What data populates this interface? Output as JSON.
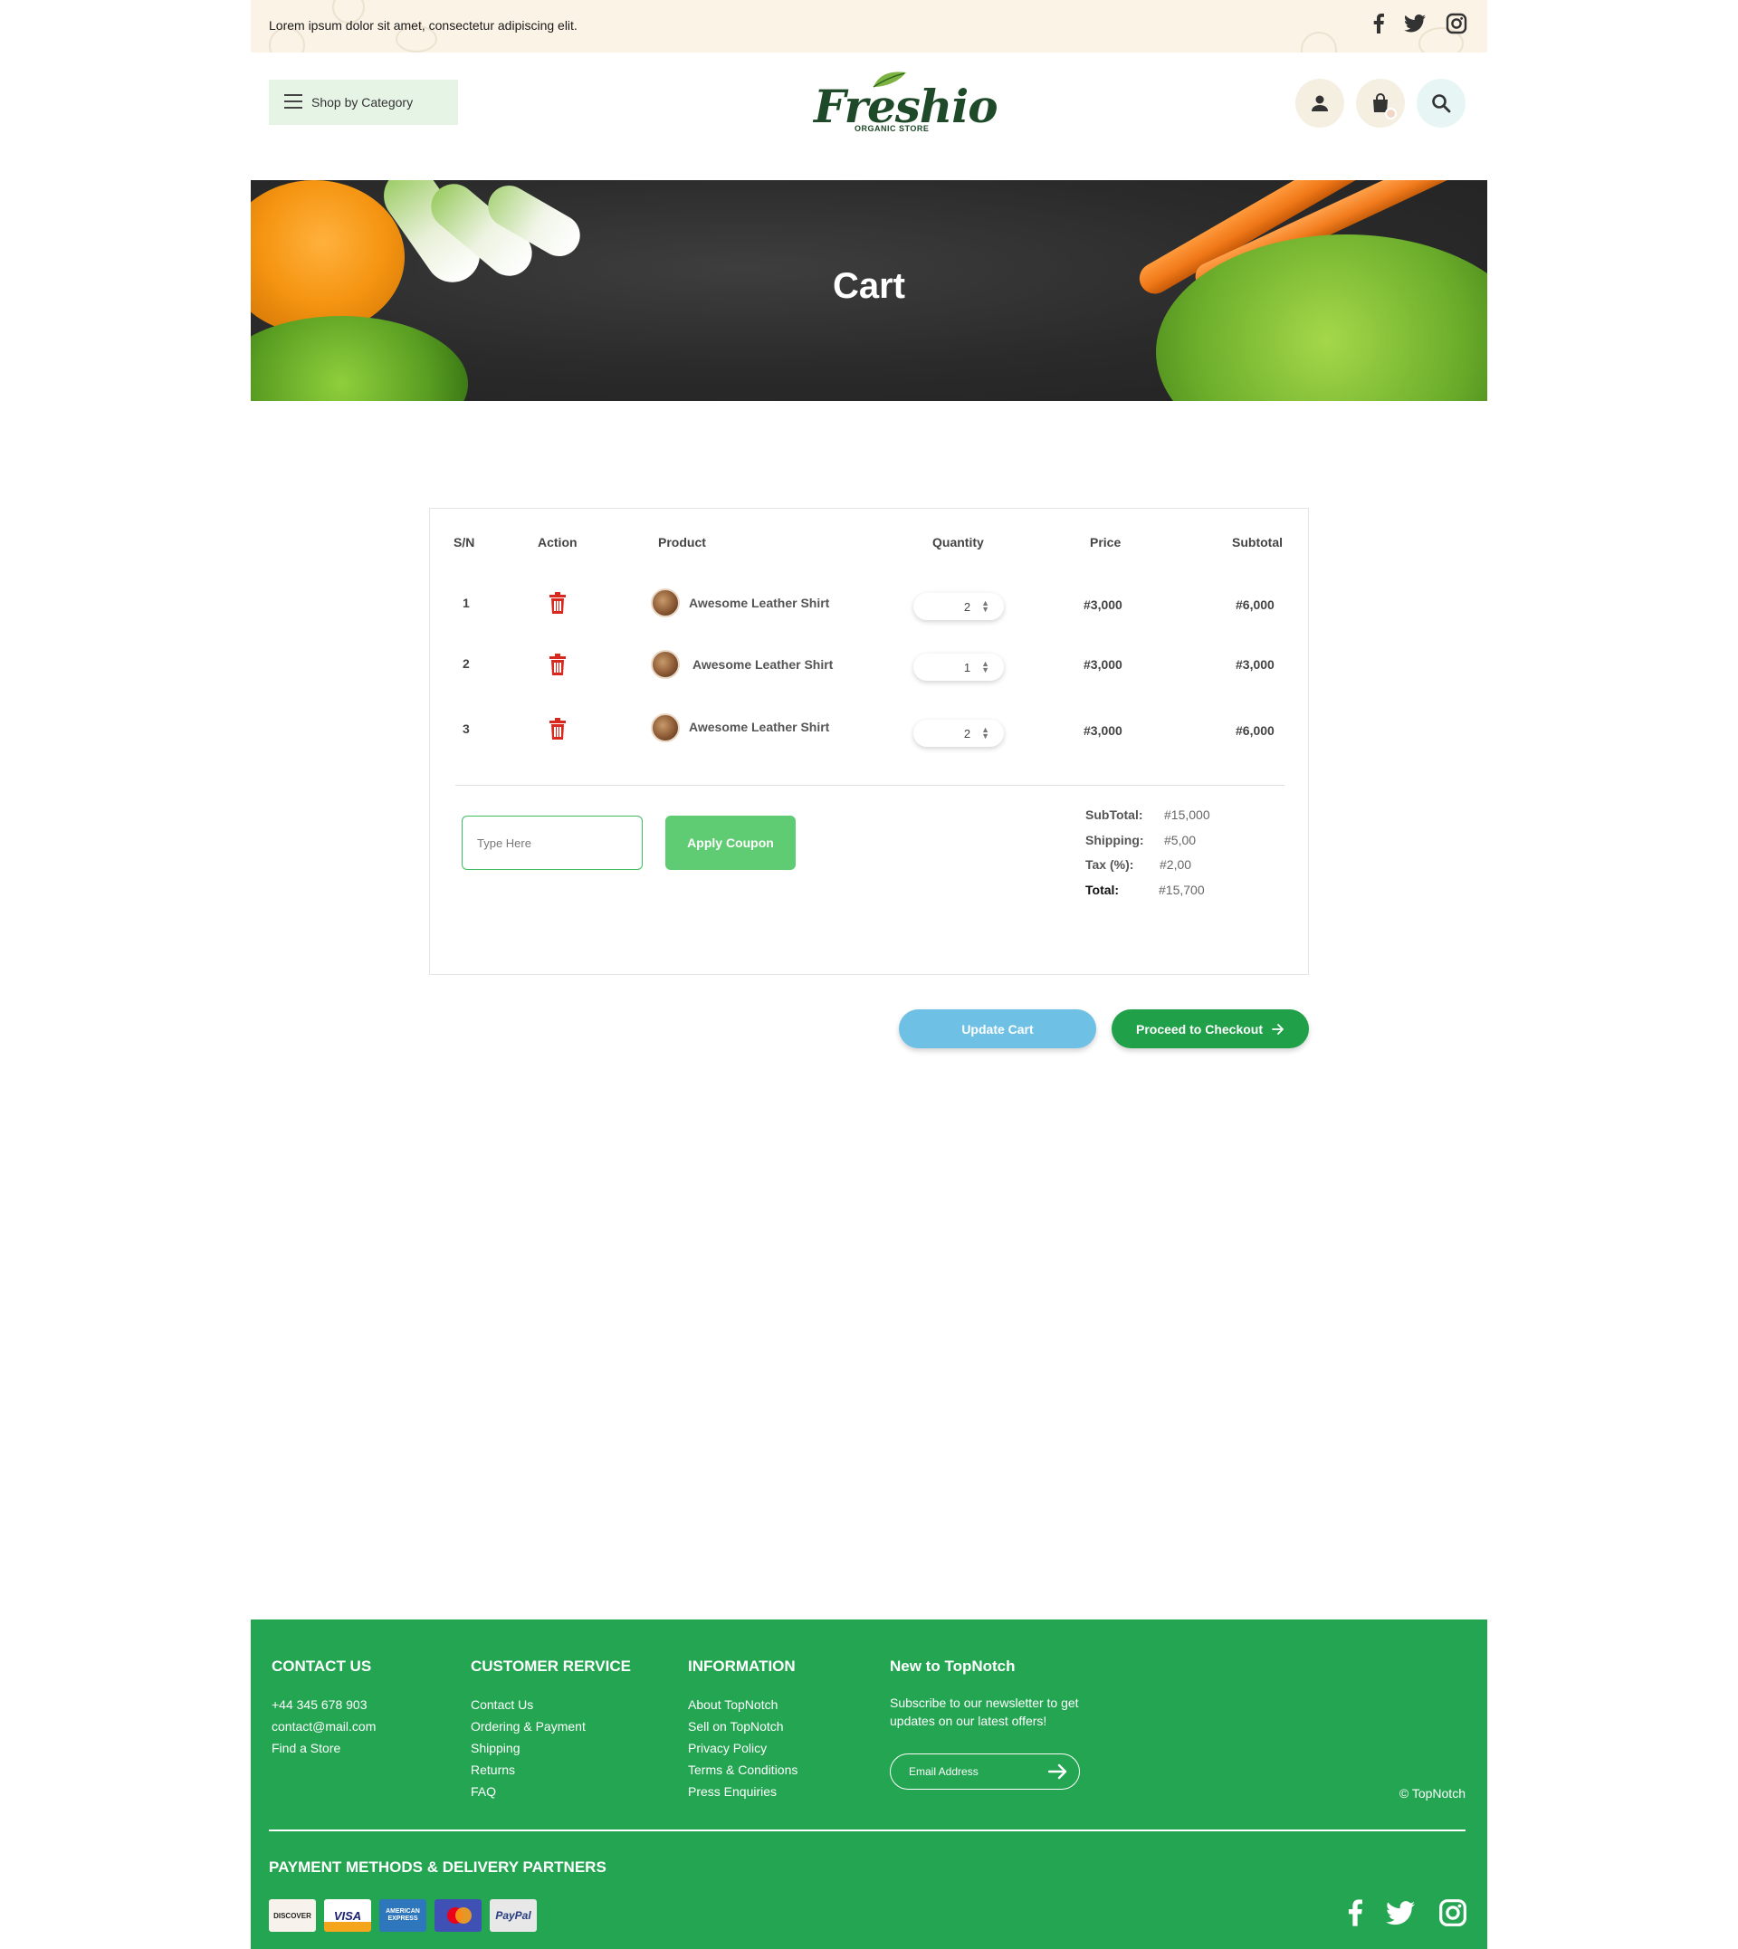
{
  "topbar": {
    "text": "Lorem ipsum dolor sit amet, consectetur adipiscing elit."
  },
  "header": {
    "category_button": "Shop by Category",
    "logo_text": "Freshio",
    "logo_subtext": "ORGANIC STORE"
  },
  "hero": {
    "title": "Cart"
  },
  "table": {
    "headers": {
      "sn": "S/N",
      "action": "Action",
      "product": "Product",
      "quantity": "Quantity",
      "price": "Price",
      "subtotal": "Subtotal"
    },
    "rows": [
      {
        "sn": "1",
        "product": "Awesome Leather Shirt",
        "quantity": "2",
        "price": "#3,000",
        "subtotal": "#6,000"
      },
      {
        "sn": "2",
        "product": "Awesome Leather Shirt",
        "quantity": "1",
        "price": "#3,000",
        "subtotal": "#3,000"
      },
      {
        "sn": "3",
        "product": "Awesome Leather Shirt",
        "quantity": "2",
        "price": "#3,000",
        "subtotal": "#6,000"
      }
    ]
  },
  "coupon": {
    "placeholder": "Type Here",
    "button": "Apply Coupon"
  },
  "totals": {
    "subtotal_label": "SubTotal:",
    "subtotal_value": "#15,000",
    "shipping_label": "Shipping:",
    "shipping_value": "#5,00",
    "tax_label": "Tax (%):",
    "tax_value": "#2,00",
    "total_label": "Total:",
    "total_value": "#15,700"
  },
  "actions": {
    "update": "Update Cart",
    "checkout": "Proceed to Checkout"
  },
  "footer": {
    "contact": {
      "title": "CONTACT US",
      "items": [
        "+44 345 678 903",
        "contact@mail.com",
        "Find a Store"
      ]
    },
    "customer": {
      "title": "CUSTOMER RERVICE",
      "items": [
        "Contact Us",
        "Ordering & Payment",
        "Shipping",
        "Returns",
        "FAQ"
      ]
    },
    "information": {
      "title": "INFORMATION",
      "items": [
        "About TopNotch",
        "Sell on TopNotch",
        "Privacy Policy",
        "Terms & Conditions",
        "Press Enquiries"
      ]
    },
    "newsletter": {
      "title": "New to TopNotch",
      "text": "Subscribe to our newsletter to get updates on our latest offers!",
      "placeholder": "Email Address"
    },
    "copyright": "© TopNotch",
    "payment_title": "PAYMENT METHODS & DELIVERY PARTNERS",
    "payment_cards": [
      "DISCOVER",
      "VISA",
      "AMERICAN EXPRESS",
      "mastercard",
      "PayPal"
    ]
  },
  "colors": {
    "brand_green": "#24a552",
    "checkout_green": "#20a048",
    "apply_green": "#5fcb72",
    "update_blue": "#6ec1e4",
    "trash_red": "#d9281e",
    "topbar_cream": "#fbf3e6"
  },
  "icons": {
    "menu": "hamburger-icon",
    "user": "user-icon",
    "bag": "shopping-bag-icon",
    "search": "search-icon",
    "delete": "trash-icon",
    "arrow": "arrow-right-icon",
    "social": [
      "facebook-icon",
      "twitter-icon",
      "instagram-icon"
    ]
  }
}
